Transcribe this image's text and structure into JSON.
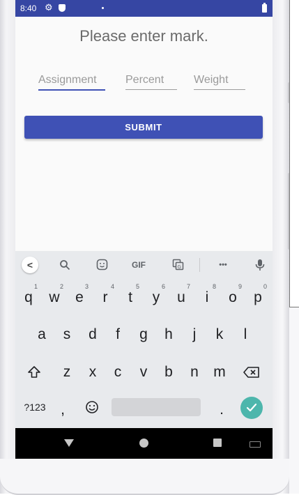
{
  "status_bar": {
    "time": "8:40"
  },
  "page": {
    "title": "Please enter mark."
  },
  "form": {
    "assignment": {
      "placeholder": "Assignment",
      "value": ""
    },
    "percent": {
      "placeholder": "Percent",
      "value": ""
    },
    "weight": {
      "placeholder": "Weight",
      "value": ""
    },
    "submit_label": "SUBMIT"
  },
  "keyboard": {
    "toolbar": {
      "back": "<",
      "gif": "GIF",
      "more": "•••"
    },
    "row1": [
      {
        "label": "q",
        "hint": "1"
      },
      {
        "label": "w",
        "hint": "2"
      },
      {
        "label": "e",
        "hint": "3"
      },
      {
        "label": "r",
        "hint": "4"
      },
      {
        "label": "t",
        "hint": "5"
      },
      {
        "label": "y",
        "hint": "6"
      },
      {
        "label": "u",
        "hint": "7"
      },
      {
        "label": "i",
        "hint": "8"
      },
      {
        "label": "o",
        "hint": "9"
      },
      {
        "label": "p",
        "hint": "0"
      }
    ],
    "row2": [
      "a",
      "s",
      "d",
      "f",
      "g",
      "h",
      "j",
      "k",
      "l"
    ],
    "row3": [
      "z",
      "x",
      "c",
      "v",
      "b",
      "n",
      "m"
    ],
    "row4": {
      "symbols": "?123",
      "comma": ",",
      "period": "."
    }
  },
  "colors": {
    "accent": "#3f51b5",
    "status_bar": "#3646a3",
    "enter_key": "#4db6ac"
  },
  "icons": [
    "gear-icon",
    "shield-icon",
    "battery-icon",
    "search-icon",
    "sticker-icon",
    "translate-icon",
    "mic-icon",
    "shift-icon",
    "backspace-icon",
    "emoji-icon",
    "check-icon",
    "nav-back-icon",
    "nav-home-icon",
    "nav-recents-icon",
    "keyboard-switch-icon"
  ]
}
